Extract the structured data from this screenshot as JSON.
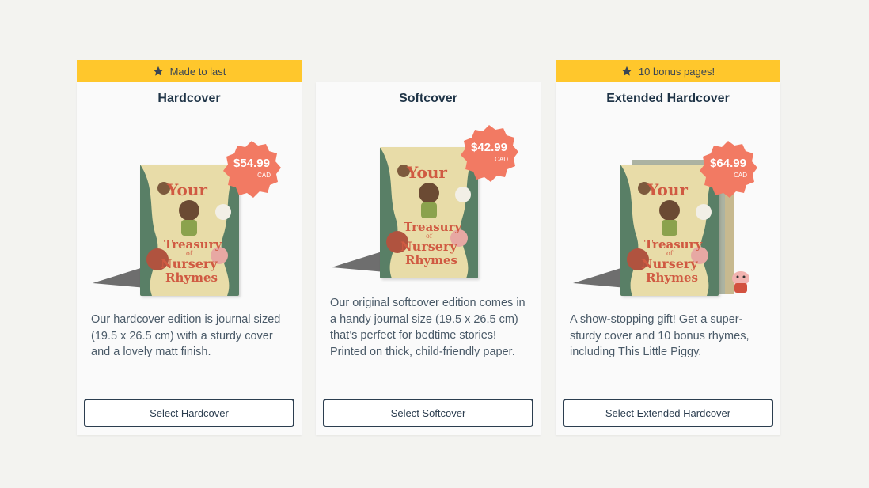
{
  "colors": {
    "ribbon": "#ffc72c",
    "price_badge": "#f27a63",
    "title": "#1f3447",
    "background": "#f3f3f0"
  },
  "book_cover_text": [
    "Your",
    "Treasury",
    "of",
    "Nursery",
    "Rhymes"
  ],
  "cards": [
    {
      "ribbon": {
        "icon": "star-icon",
        "text": "Made to last"
      },
      "title": "Hardcover",
      "price": "$54.99",
      "currency": "CAD",
      "description": "Our hardcover edition is journal sized (19.5 x 26.5 cm) with a sturdy cover and a lovely matt finish.",
      "button": "Select Hardcover"
    },
    {
      "title": "Softcover",
      "price": "$42.99",
      "currency": "CAD",
      "description": "Our original softcover edition comes in a handy journal size (19.5 x 26.5 cm) that’s perfect for bedtime stories! Printed on thick, child-friendly paper.",
      "button": "Select Softcover"
    },
    {
      "ribbon": {
        "icon": "star-icon",
        "text": "10 bonus pages!"
      },
      "title": "Extended Hardcover",
      "price": "$64.99",
      "currency": "CAD",
      "description": "A show-stopping gift! Get a super-sturdy cover and 10 bonus rhymes, including This Little Piggy.",
      "button": "Select Extended Hardcover"
    }
  ]
}
